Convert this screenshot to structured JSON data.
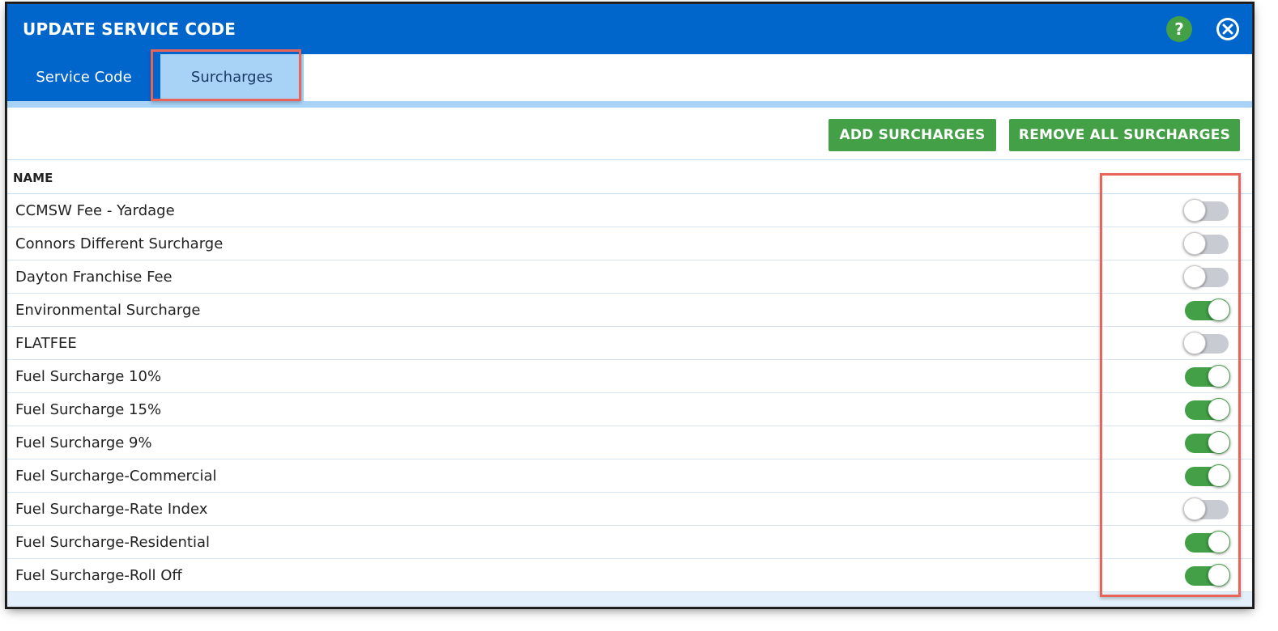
{
  "dialog": {
    "title": "UPDATE SERVICE CODE",
    "help_icon": "help-icon",
    "help_symbol": "?",
    "close_icon": "close-icon"
  },
  "tabs": [
    {
      "label": "Service Code",
      "active": false
    },
    {
      "label": "Surcharges",
      "active": true
    }
  ],
  "toolbar": {
    "add_label": "ADD SURCHARGES",
    "remove_label": "REMOVE ALL SURCHARGES"
  },
  "table": {
    "header": "NAME",
    "rows": [
      {
        "name": "CCMSW Fee - Yardage",
        "enabled": false
      },
      {
        "name": "Connors Different Surcharge",
        "enabled": false
      },
      {
        "name": "Dayton Franchise Fee",
        "enabled": false
      },
      {
        "name": "Environmental Surcharge",
        "enabled": true
      },
      {
        "name": "FLATFEE",
        "enabled": false
      },
      {
        "name": "Fuel Surcharge 10%",
        "enabled": true
      },
      {
        "name": "Fuel Surcharge 15%",
        "enabled": true
      },
      {
        "name": "Fuel Surcharge 9%",
        "enabled": true
      },
      {
        "name": "Fuel Surcharge-Commercial",
        "enabled": true
      },
      {
        "name": "Fuel Surcharge-Rate Index",
        "enabled": false
      },
      {
        "name": "Fuel Surcharge-Residential",
        "enabled": true
      },
      {
        "name": "Fuel Surcharge-Roll Off",
        "enabled": true
      }
    ]
  },
  "colors": {
    "header_blue": "#0066cc",
    "tab_active": "#a8d3f7",
    "green": "#43a047",
    "highlight_red": "#e8645a",
    "toggle_off": "#c8ccd2"
  }
}
